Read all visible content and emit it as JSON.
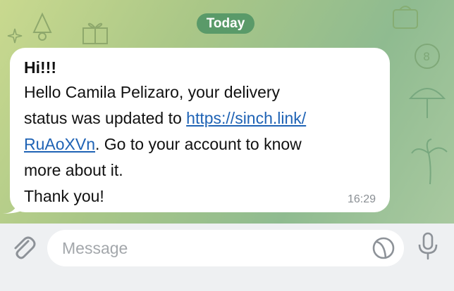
{
  "chat": {
    "day_label": "Today",
    "message": {
      "title": "Hi!!!",
      "line1": "Hello Camila Pelizaro, your delivery",
      "line2_text": "status was updated to ",
      "link_part1": "https://sinch.link/",
      "link_part2": "RuAoXVn",
      "line3_rest": ". Go to your account to know",
      "line4": "more about it.",
      "line5": "Thank you!",
      "time": "16:29"
    }
  },
  "composer": {
    "placeholder": "Message"
  },
  "colors": {
    "day_chip": "#5a9a69",
    "link": "#1f63b5",
    "chat_background": "#aac787"
  },
  "icons": [
    "paperclip-icon",
    "sticker-icon",
    "microphone-icon"
  ]
}
